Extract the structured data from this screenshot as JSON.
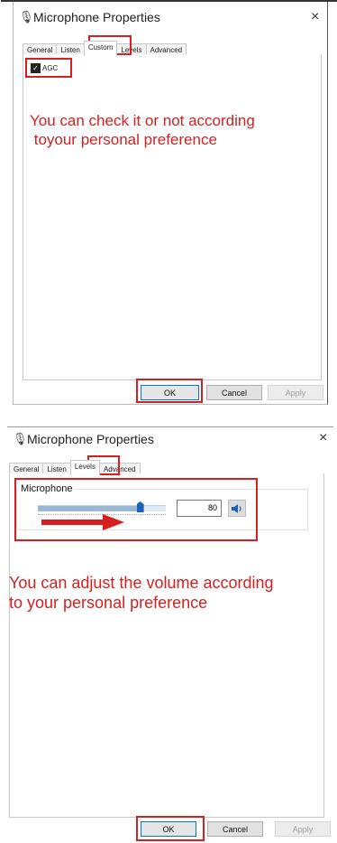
{
  "dialog1": {
    "title": "Microphone Properties",
    "close_glyph": "×",
    "tabs": [
      {
        "label": "General"
      },
      {
        "label": "Listen"
      },
      {
        "label": "Custom"
      },
      {
        "label": "Levels"
      },
      {
        "label": "Advanced"
      }
    ],
    "active_tab": "Custom",
    "agc": {
      "label": "AGC",
      "checked": true
    },
    "annotation_line1": "You can check it or not according",
    "annotation_line2": " toyour personal preference",
    "buttons": {
      "ok": "OK",
      "cancel": "Cancel",
      "apply": "Apply"
    }
  },
  "dialog2": {
    "title": "Microphone Properties",
    "close_glyph": "×",
    "tabs": [
      {
        "label": "General"
      },
      {
        "label": "Listen"
      },
      {
        "label": "Levels"
      },
      {
        "label": "Advanced"
      }
    ],
    "active_tab": "Levels",
    "group_label": "Microphone",
    "volume_value": "80",
    "volume_percent": 80,
    "annotation_line1": "You can adjust the volume according",
    "annotation_line2": "to your personal preference",
    "buttons": {
      "ok": "OK",
      "cancel": "Cancel",
      "apply": "Apply"
    }
  },
  "colors": {
    "annotation": "#d62020",
    "accent": "#0078d7",
    "slider_thumb": "#1a62b5"
  },
  "icons": {
    "title_icon": "microphone-icon",
    "speaker": "speaker-icon",
    "arrow": "red-arrow"
  }
}
